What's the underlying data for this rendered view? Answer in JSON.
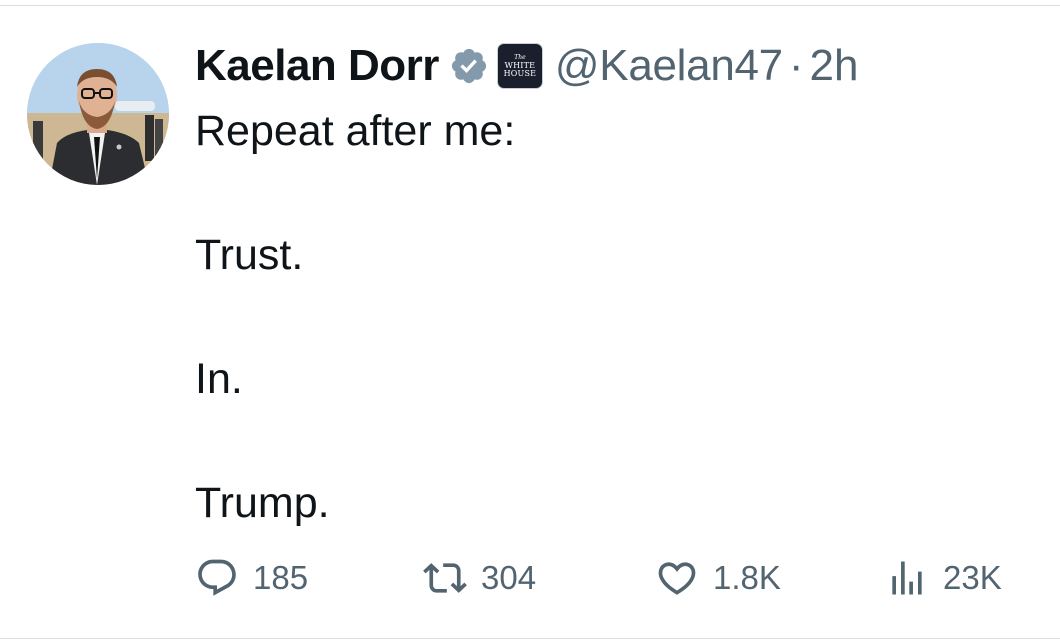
{
  "tweet": {
    "author_name": "Kaelan Dorr",
    "handle": "@Kaelan47",
    "separator": "·",
    "time": "2h",
    "affiliation_badge": {
      "line1": "The",
      "line2": "WHITE",
      "line3": "HOUSE"
    },
    "verified_color": "#829aab",
    "body_lines": [
      "Repeat after me:",
      "",
      "Trust.",
      "",
      "In.",
      "",
      "Trump."
    ]
  },
  "actions": {
    "replies": {
      "icon": "reply-icon",
      "count": "185"
    },
    "reposts": {
      "icon": "repost-icon",
      "count": "304"
    },
    "likes": {
      "icon": "heart-icon",
      "count": "1.8K"
    },
    "views": {
      "icon": "views-icon",
      "count": "23K"
    }
  },
  "colors": {
    "text": "#0f1419",
    "secondary": "#536471"
  }
}
